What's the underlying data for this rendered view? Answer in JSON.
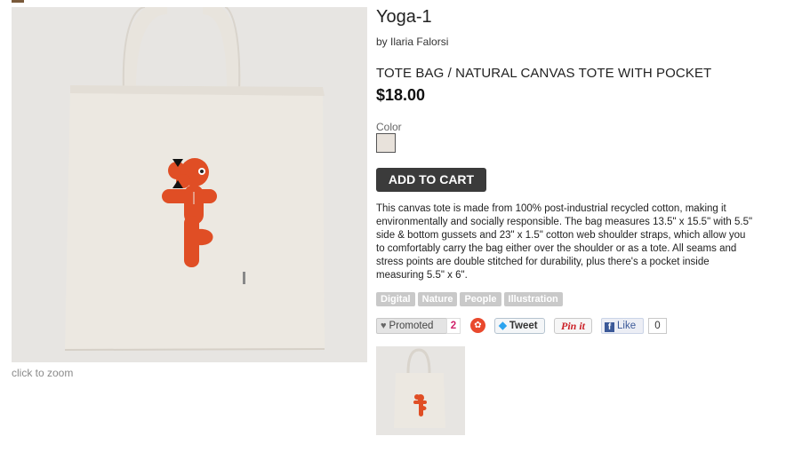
{
  "product": {
    "title": "Yoga-1",
    "author": "by Ilaria Falorsi",
    "subtitle": "TOTE BAG / NATURAL CANVAS TOTE WITH POCKET",
    "price": "$18.00",
    "color_label": "Color",
    "color_swatch": "#e8e2db",
    "add_to_cart": "ADD TO CART",
    "description": "This canvas tote is made from 100% post-industrial recycled cotton, making it environmentally and socially responsible. The bag measures 13.5\" x 15.5\" with 5.5\" side & bottom gussets and 23\" x 1.5\" cotton web shoulder straps, which allow you to comfortably carry the bag either over the shoulder or as a tote. All seams and stress points are double stitched for durability, plus there's a pocket inside measuring 5.5\" x 6\"."
  },
  "image": {
    "zoom_hint": "click to zoom"
  },
  "tags": [
    "Digital",
    "Nature",
    "People",
    "Illustration"
  ],
  "social": {
    "promoted_label": "Promoted",
    "promoted_count": "2",
    "tweet_label": "Tweet",
    "pinit_label": "Pin it",
    "like_label": "Like",
    "like_count": "0"
  },
  "colors": {
    "button_dark": "#3b3b3b",
    "accent_orange": "#e04e25",
    "tag_gray": "#c9c9c9"
  }
}
